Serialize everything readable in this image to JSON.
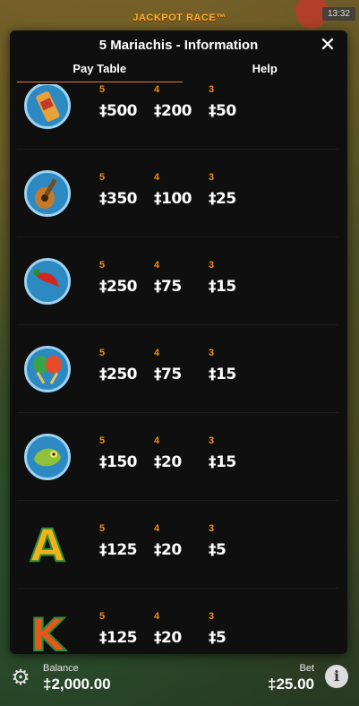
{
  "status_bar": {
    "time": "13:32"
  },
  "game": {
    "banner": "JACKPOT RACE™"
  },
  "modal": {
    "title": "5 Mariachis - Information",
    "close_glyph": "✕",
    "tabs": [
      {
        "label": "Pay Table",
        "active": true
      },
      {
        "label": "Help",
        "active": false
      }
    ]
  },
  "pay_table": {
    "rows": [
      {
        "symbol": "tequila-bottle-icon",
        "counts": [
          "5",
          "4",
          "3"
        ],
        "amounts": [
          "‡500",
          "‡200",
          "‡50"
        ]
      },
      {
        "symbol": "guitar-icon",
        "counts": [
          "5",
          "4",
          "3"
        ],
        "amounts": [
          "‡350",
          "‡100",
          "‡25"
        ]
      },
      {
        "symbol": "chili-pepper-icon",
        "counts": [
          "5",
          "4",
          "3"
        ],
        "amounts": [
          "‡250",
          "‡75",
          "‡15"
        ]
      },
      {
        "symbol": "maracas-icon",
        "counts": [
          "5",
          "4",
          "3"
        ],
        "amounts": [
          "‡250",
          "‡75",
          "‡15"
        ]
      },
      {
        "symbol": "chameleon-icon",
        "counts": [
          "5",
          "4",
          "3"
        ],
        "amounts": [
          "‡150",
          "‡20",
          "‡15"
        ]
      },
      {
        "symbol": "letter-a-icon",
        "letter": "A",
        "counts": [
          "5",
          "4",
          "3"
        ],
        "amounts": [
          "‡125",
          "‡20",
          "‡5"
        ]
      },
      {
        "symbol": "letter-k-icon",
        "letter": "K",
        "counts": [
          "5",
          "4",
          "3"
        ],
        "amounts": [
          "‡125",
          "‡20",
          "‡5"
        ]
      }
    ]
  },
  "footer": {
    "balance_label": "Balance",
    "balance_value": "‡2,000.00",
    "bet_label": "Bet",
    "bet_value": "‡25.00",
    "settings_icon": "gear-icon",
    "info_glyph": "i"
  },
  "colors": {
    "accent": "#f28c1b",
    "panel": "#0f0f0f",
    "symbol_ring": "#9fd3f0"
  }
}
